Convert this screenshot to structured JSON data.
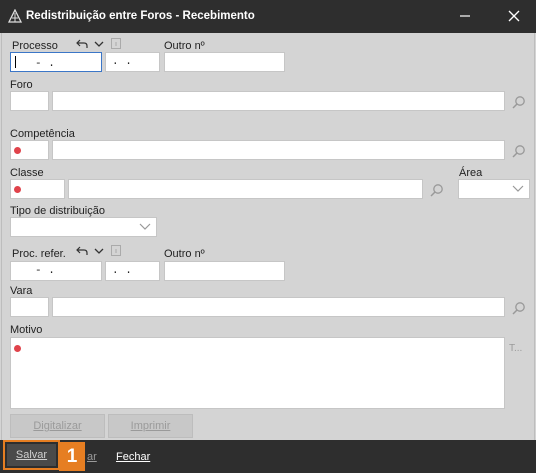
{
  "window": {
    "title": "Redistribuição entre Foros - Recebimento",
    "close_icon": "close-icon",
    "minimize_icon": "minimize-icon",
    "maximize_icon": "chevron-down-icon"
  },
  "processo": {
    "label": "Processo",
    "value1": "- .",
    "value2": ". .",
    "undo_icon": "undo-icon",
    "chevron_icon": "chevron-down-icon",
    "info_icon": "info-icon"
  },
  "outro_no_1": {
    "label": "Outro nº",
    "value": ""
  },
  "foro": {
    "label": "Foro",
    "code": "",
    "name": ""
  },
  "competencia": {
    "label": "Competência",
    "code": "",
    "name": ""
  },
  "classe": {
    "label": "Classe",
    "code": "",
    "name": ""
  },
  "area": {
    "label": "Área",
    "value": ""
  },
  "tipo_distribuicao": {
    "label": "Tipo de distribuição",
    "value": ""
  },
  "proc_refer": {
    "label": "Proc. refer.",
    "value1": "- .",
    "value2": ". ."
  },
  "outro_no_2": {
    "label": "Outro nº",
    "value": ""
  },
  "vara": {
    "label": "Vara",
    "code": "",
    "name": ""
  },
  "motivo": {
    "label": "Motivo",
    "value": "",
    "expand_label": "T..."
  },
  "actions": {
    "digitalizar": "Digitalizar",
    "imprimir": "Imprimir"
  },
  "bottom": {
    "salvar": "Salvar",
    "partial": "ar",
    "fechar": "Fechar",
    "badge": "1"
  },
  "colors": {
    "accent": "#e67e22",
    "required": "#e0434b",
    "focus": "#3b76c7",
    "bar": "#2e2e2e"
  }
}
